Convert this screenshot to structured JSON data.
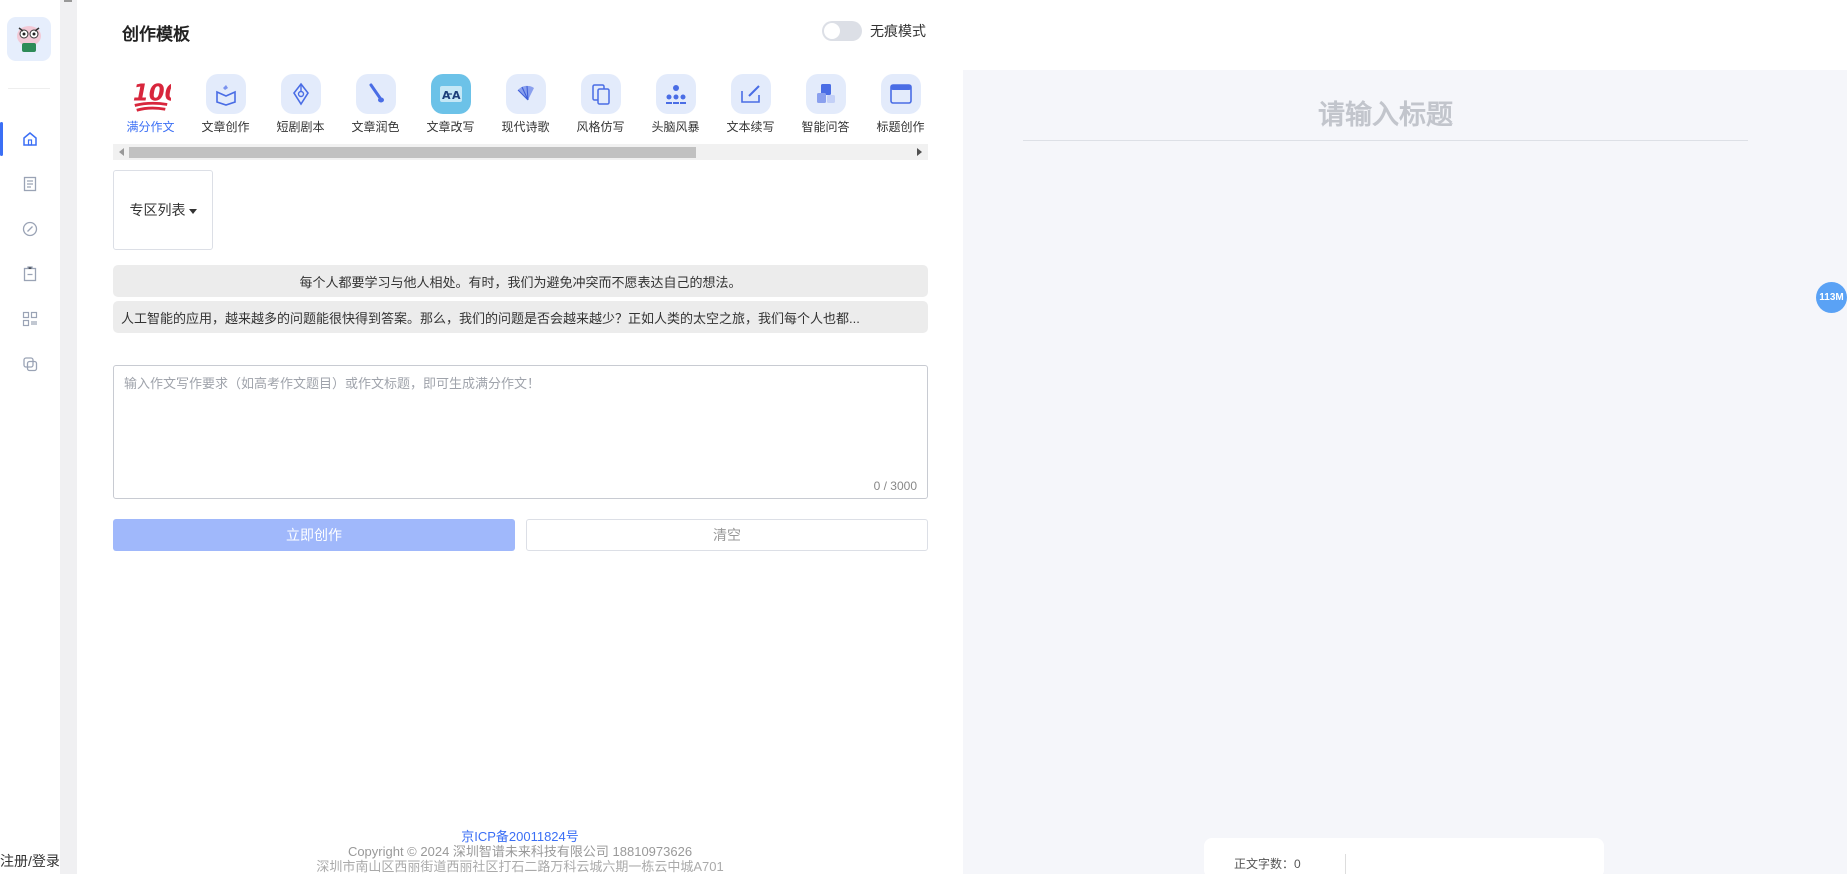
{
  "nav": {
    "login_label": "注册/登录"
  },
  "header": {
    "title": "创作模板",
    "incognito_label": "无痕模式",
    "incognito_on": false
  },
  "templates": [
    {
      "label": "满分作文",
      "icon": "hundred-points-icon",
      "active": true
    },
    {
      "label": "文章创作",
      "icon": "article-create-icon"
    },
    {
      "label": "短剧剧本",
      "icon": "pen-nib-icon"
    },
    {
      "label": "文章润色",
      "icon": "paint-brush-icon"
    },
    {
      "label": "文章改写",
      "icon": "translate-ab-icon"
    },
    {
      "label": "现代诗歌",
      "icon": "fan-icon"
    },
    {
      "label": "风格仿写",
      "icon": "copy-pages-icon"
    },
    {
      "label": "头脑风暴",
      "icon": "people-group-icon"
    },
    {
      "label": "文本续写",
      "icon": "edit-box-icon"
    },
    {
      "label": "智能问答",
      "icon": "qa-cards-icon"
    },
    {
      "label": "标题创作",
      "icon": "browser-window-icon"
    }
  ],
  "zone": {
    "label": "专区列表"
  },
  "suggestions": [
    "每个人都要学习与他人相处。有时，我们为避免冲突而不愿表达自己的想法。",
    "人工智能的应用，越来越多的问题能很快得到答案。那么，我们的问题是否会越来越少？正如人类的太空之旅，我们每个人也都..."
  ],
  "editor": {
    "placeholder": "输入作文写作要求（如高考作文题目）或作文标题，即可生成满分作文！",
    "value": "",
    "counter": "0 / 3000"
  },
  "actions": {
    "create_label": "立即创作",
    "clear_label": "清空"
  },
  "footer": {
    "icp": "京ICP备20011824号",
    "copyright": "Copyright © 2024 深圳智谱未来科技有限公司 18810973626",
    "address": "深圳市南山区西丽街道西丽社区打石二路万科云城六期一栋云中城A701"
  },
  "preview": {
    "title_placeholder": "请输入标题",
    "word_count": "正文字数：0"
  },
  "memory_badge": "113M",
  "colors": {
    "accent": "#3b6ff5",
    "primary_button": "#a0b8fb",
    "preview_bg": "#f5f6fa"
  }
}
